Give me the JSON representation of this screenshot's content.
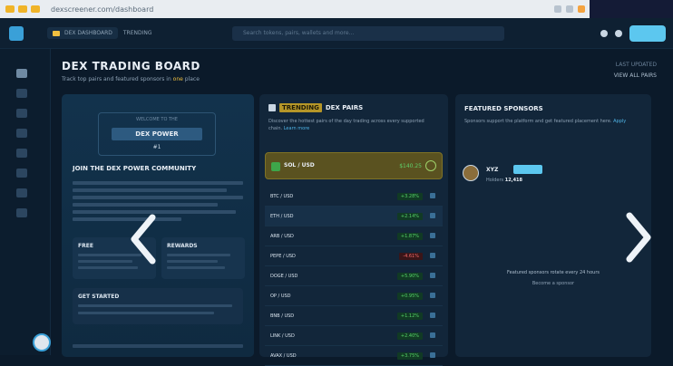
{
  "browser": {
    "url": "dexscreener.com/dashboard"
  },
  "nav": {
    "active_tab": "DEX DASHBOARD",
    "second_tab": "TRENDING",
    "search_placeholder": "Search tokens, pairs, wallets and more..."
  },
  "page": {
    "title": "DEX TRADING BOARD",
    "subtitle_prefix": "Track top pairs and featured sponsors in",
    "subtitle_highlight": "one",
    "subtitle_suffix": "place",
    "top_right_1": "LAST UPDATED",
    "top_right_2": "VIEW ALL PAIRS"
  },
  "left_panel": {
    "hero_small": "WELCOME TO THE",
    "hero_title": "DEX POWER",
    "hero_sub": "#1",
    "join_title": "JOIN THE DEX POWER COMMUNITY",
    "box_1_title": "FREE",
    "box_2_title": "REWARDS",
    "wide_title": "GET STARTED"
  },
  "mid_panel": {
    "head_prefix": "",
    "head_highlight": "TRENDING",
    "head_suffix": "DEX PAIRS",
    "desc": "Discover the hottest pairs of the day trading across every supported chain.",
    "desc_link": "Learn more",
    "featured": {
      "name": "SOL / USD",
      "price": "$140.25"
    },
    "pairs": [
      {
        "name": "BTC / USD",
        "value": "+3.28%",
        "sign": "pos"
      },
      {
        "name": "ETH / USD",
        "value": "+2.14%",
        "sign": "pos"
      },
      {
        "name": "ARB / USD",
        "value": "+1.87%",
        "sign": "pos"
      },
      {
        "name": "PEPE / USD",
        "value": "-4.61%",
        "sign": "neg"
      },
      {
        "name": "DOGE / USD",
        "value": "+5.90%",
        "sign": "pos"
      },
      {
        "name": "OP / USD",
        "value": "+0.95%",
        "sign": "pos"
      },
      {
        "name": "BNB / USD",
        "value": "+1.12%",
        "sign": "pos"
      },
      {
        "name": "LINK / USD",
        "value": "+2.40%",
        "sign": "pos"
      },
      {
        "name": "AVAX / USD",
        "value": "+3.75%",
        "sign": "pos"
      }
    ]
  },
  "right_panel": {
    "head": "FEATURED SPONSORS",
    "desc": "Sponsors support the platform and get featured placement here.",
    "desc_link": "Apply",
    "sponsor_name": "XYZ",
    "sponsor_stats_label": "Holders",
    "sponsor_stats_value": "12,418",
    "note": "Featured sponsors rotate every 24 hours",
    "note2": "Become a sponsor"
  },
  "colors": {
    "accent": "#5cc7ef",
    "highlight": "#f0c040",
    "positive": "#56d36a",
    "negative": "#f26a6a"
  }
}
